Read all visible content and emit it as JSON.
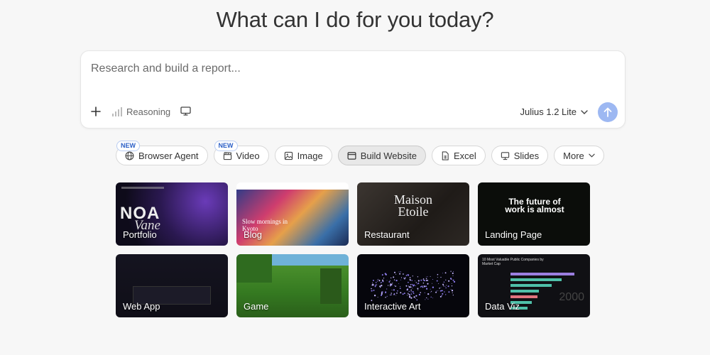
{
  "headline": "What can I do for you today?",
  "prompt": {
    "placeholder": "Research and build a report...",
    "reasoning_label": "Reasoning",
    "model_label": "Julius 1.2 Lite",
    "send_color": "#9db8f2"
  },
  "chips": [
    {
      "label": "Browser Agent",
      "icon": "globe-icon",
      "badge": "NEW"
    },
    {
      "label": "Video",
      "icon": "clapperboard-icon",
      "badge": "NEW"
    },
    {
      "label": "Image",
      "icon": "image-icon"
    },
    {
      "label": "Build Website",
      "icon": "browser-window-icon",
      "active": true
    },
    {
      "label": "Excel",
      "icon": "spreadsheet-file-icon"
    },
    {
      "label": "Slides",
      "icon": "presentation-icon"
    },
    {
      "label": "More",
      "icon": "chevron-down-icon"
    }
  ],
  "cards": [
    {
      "label": "Portfolio",
      "preview_text": "NOA",
      "preview_script": "Vane"
    },
    {
      "label": "Blog",
      "preview_text": "Slow mornings in Kyoto"
    },
    {
      "label": "Restaurant",
      "preview_text": "Maison\nEtoile"
    },
    {
      "label": "Landing Page",
      "preview_text": "The future of work is almost"
    },
    {
      "label": "Web App"
    },
    {
      "label": "Game"
    },
    {
      "label": "Interactive Art"
    },
    {
      "label": "Data Viz",
      "preview_text": "10 Most Valuable Public Companies by Market Cap",
      "preview_year": "2000"
    }
  ]
}
